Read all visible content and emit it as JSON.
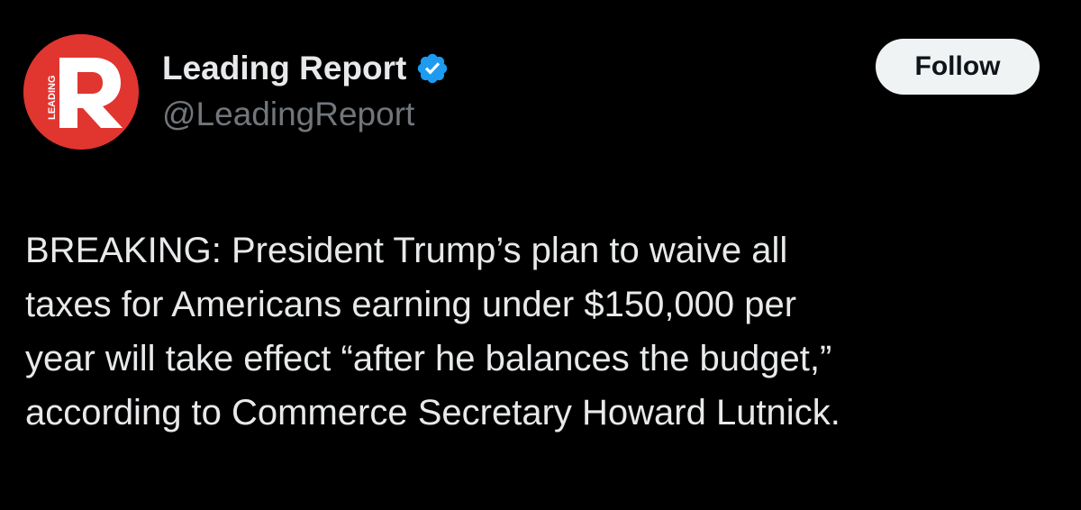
{
  "author": {
    "display_name": "Leading Report",
    "handle": "@LeadingReport",
    "verified_icon": "verified-badge-icon",
    "avatar_letter": "R",
    "avatar_side_text": "LEADING",
    "avatar_color": "#e13530"
  },
  "follow_button": {
    "label": "Follow"
  },
  "tweet": {
    "lines": [
      "BREAKING: President Trump’s plan to waive all",
      "taxes for Americans earning under $150,000 per",
      "year will take effect “after he balances the budget,”",
      "according to Commerce Secretary Howard Lutnick."
    ]
  },
  "colors": {
    "background": "#000000",
    "text": "#e7e9ea",
    "muted": "#71767b",
    "verified": "#1d9bf0",
    "button_bg": "#eff3f4"
  }
}
